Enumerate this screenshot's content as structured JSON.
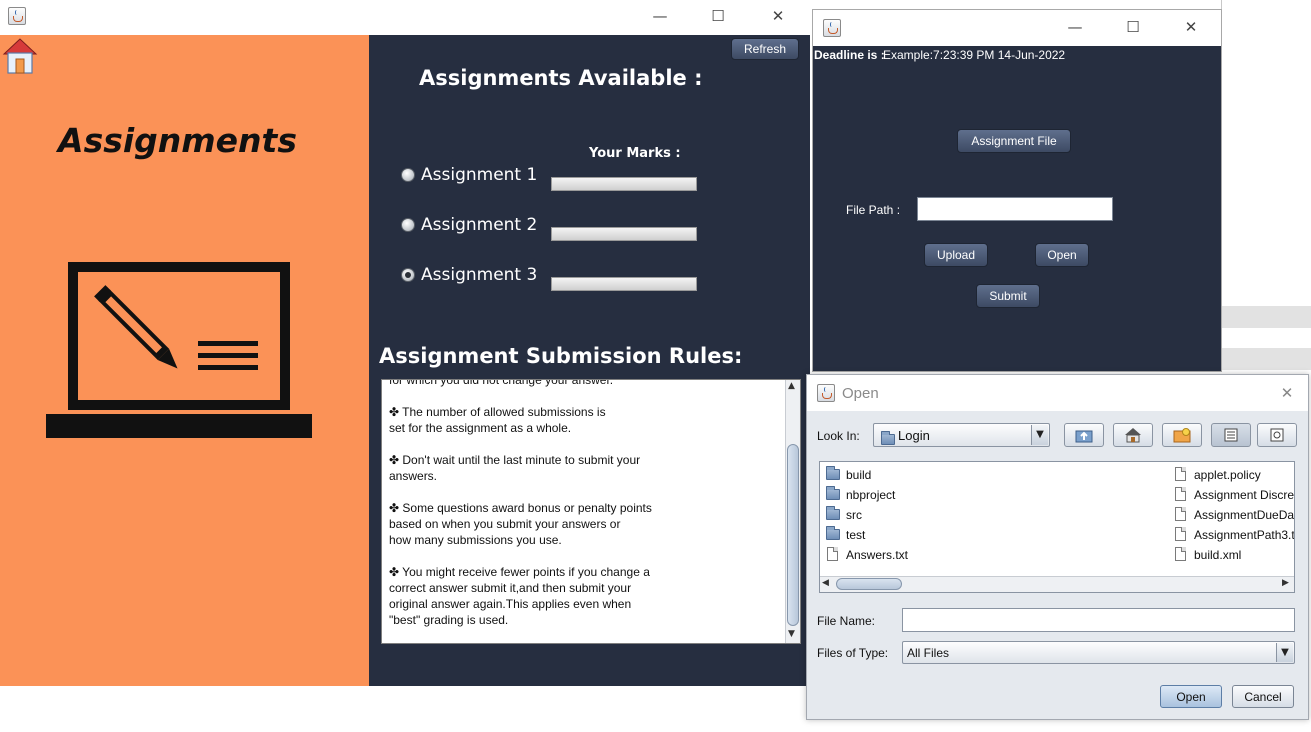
{
  "main_window": {
    "refresh_label": "Refresh",
    "heading": "Assignments",
    "available_title": "Assignments Available :",
    "marks_label": "Your Marks :",
    "assignments": [
      {
        "label": "Assignment 1",
        "selected": false
      },
      {
        "label": "Assignment 2",
        "selected": false
      },
      {
        "label": "Assignment 3",
        "selected": true
      }
    ],
    "rules_title": "Assignment Submission Rules:",
    "rules_lines": [
      "for which you did not change your answer.",
      "✤ The number of allowed submissions is",
      "set for the assignment as a whole.",
      "✤ Don't wait until the last minute to submit your",
      "answers.",
      "✤ Some questions award bonus or penalty points",
      "based on when you submit your answers or",
      "how many submissions you use.",
      "✤ You might receive fewer points if you change a",
      "correct answer  submit it,and then submit your",
      "original answer again.This applies even when",
      "\"best\" grading is used."
    ],
    "icons": [
      "home-icon",
      "laptop-pencil-icon"
    ],
    "colors": {
      "left_panel": "#fb9257",
      "right_panel": "#262e40"
    }
  },
  "submission_window": {
    "deadline_label": "Deadline is :",
    "deadline_value": "Example:7:23:39 PM 14-Jun-2022",
    "assignment_file_label": "Assignment File",
    "file_path_label": "File Path :",
    "file_path_value": "",
    "upload_label": "Upload",
    "open_label": "Open",
    "submit_label": "Submit"
  },
  "open_dialog": {
    "title": "Open",
    "look_in_label": "Look In:",
    "look_in_value": "Login",
    "folders": [
      "build",
      "nbproject",
      "src",
      "test"
    ],
    "files_left": [
      "Answers.txt"
    ],
    "files_right": [
      "applet.policy",
      "Assignment Discre",
      "AssignmentDueDa",
      "AssignmentPath3.t",
      "build.xml"
    ],
    "file_name_label": "File Name:",
    "file_name_value": "",
    "files_of_type_label": "Files of Type:",
    "files_of_type_value": "All Files",
    "open_label": "Open",
    "cancel_label": "Cancel"
  },
  "window_controls": {
    "minimize": "—",
    "maximize": "☐",
    "close": "✕"
  }
}
